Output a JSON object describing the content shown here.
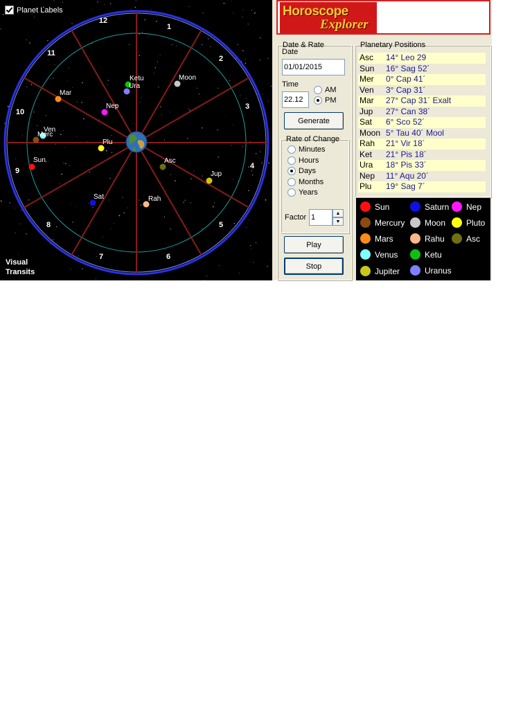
{
  "wheel": {
    "planet_labels_checkbox": {
      "label": "Planet Labels",
      "checked": true
    },
    "visual_label_line1": "Visual",
    "visual_label_line2": "Transits",
    "houses": [
      "1",
      "2",
      "3",
      "4",
      "5",
      "6",
      "7",
      "8",
      "9",
      "10",
      "11",
      "12"
    ],
    "planets": [
      {
        "label": "Ketu",
        "color": "#10c010"
      },
      {
        "label": "Ura",
        "color": "#8080ff"
      },
      {
        "label": "Moon",
        "color": "#c8c8c8"
      },
      {
        "label": "Mar",
        "color": "#ff8c18"
      },
      {
        "label": "Nep",
        "color": "#ff18ff"
      },
      {
        "label": "Ven",
        "color": "#80ffff"
      },
      {
        "label": "Merc",
        "color": "#8c4a10"
      },
      {
        "label": "Plu",
        "color": "#ffff10"
      },
      {
        "label": "Sun",
        "color": "#ff1010"
      },
      {
        "label": "Asc",
        "color": "#707010"
      },
      {
        "label": "Jup",
        "color": "#c8c818"
      },
      {
        "label": "Sat",
        "color": "#1010e0"
      },
      {
        "label": "Rah",
        "color": "#ffb888"
      }
    ]
  },
  "logo": {
    "line1": "Horoscope",
    "line2": "Explorer"
  },
  "date_rate": {
    "legend": "Date & Rate",
    "date_label": "Date",
    "date_value": "01/01/2015",
    "time_label": "Time",
    "time_value": "22.12",
    "am_label": "AM",
    "pm_label": "PM",
    "ampm_selected": "PM",
    "generate_label": "Generate",
    "rate_legend": "Rate of Change",
    "rate_options": [
      "Minutes",
      "Hours",
      "Days",
      "Months",
      "Years"
    ],
    "rate_selected": "Days",
    "factor_label": "Factor",
    "factor_value": "1",
    "play_label": "Play",
    "stop_label": "Stop"
  },
  "positions": {
    "legend": "Planetary Positions",
    "rows": [
      {
        "name": "Asc",
        "value": "14° Leo 29"
      },
      {
        "name": "Sun",
        "value": "16° Sag 52´"
      },
      {
        "name": "Mer",
        "value": "0° Cap 41´"
      },
      {
        "name": "Ven",
        "value": "3° Cap 31´"
      },
      {
        "name": "Mar",
        "value": "27° Cap 31´ Exalt"
      },
      {
        "name": "Jup",
        "value": "27° Can 38´"
      },
      {
        "name": "Sat",
        "value": "6° Sco 52´"
      },
      {
        "name": "Moon",
        "value": "5° Tau 40´ Mool"
      },
      {
        "name": "Rah",
        "value": "21° Vir 18´"
      },
      {
        "name": "Ket",
        "value": "21° Pis 18´"
      },
      {
        "name": "Ura",
        "value": "18° Pis 33´"
      },
      {
        "name": "Nep",
        "value": "11° Aqu 20´"
      },
      {
        "name": "Plu",
        "value": "19° Sag 7´"
      }
    ]
  },
  "legend": [
    {
      "label": "Sun",
      "color": "#ff1010"
    },
    {
      "label": "Saturn",
      "color": "#1010e0"
    },
    {
      "label": "Nep",
      "color": "#ff18ff"
    },
    {
      "label": "Mercury",
      "color": "#8c4a10"
    },
    {
      "label": "Moon",
      "color": "#c8c8c8"
    },
    {
      "label": "Pluto",
      "color": "#ffff10"
    },
    {
      "label": "Mars",
      "color": "#ff8c18"
    },
    {
      "label": "Rahu",
      "color": "#ffb888"
    },
    {
      "label": "Asc",
      "color": "#707010"
    },
    {
      "label": "Venus",
      "color": "#80ffff"
    },
    {
      "label": "Ketu",
      "color": "#10c010"
    },
    {
      "label": "Jupiter",
      "color": "#c8c818"
    },
    {
      "label": "Uranus",
      "color": "#8080ff"
    }
  ]
}
